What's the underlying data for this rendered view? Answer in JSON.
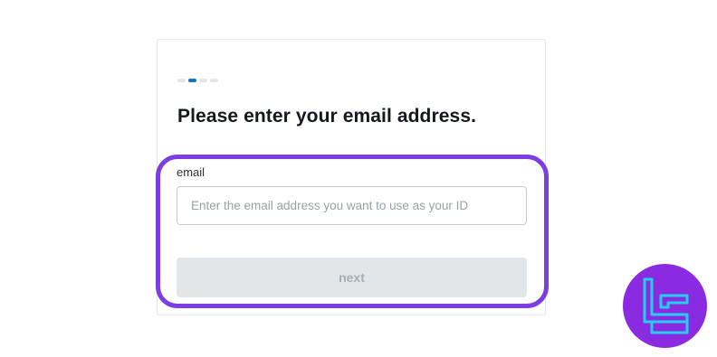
{
  "form": {
    "progress": {
      "total_steps": 4,
      "current_step": 2
    },
    "title": "Please enter your email address.",
    "email": {
      "label": "email",
      "value": "",
      "placeholder": "Enter the email address you want to use as your ID"
    },
    "next_label": "next",
    "next_enabled": false
  },
  "colors": {
    "accent": "#1a73c9",
    "highlight": "#7c3ee0",
    "logo_bg": "#8a2be2",
    "logo_mark": "#20d0f0",
    "button_disabled_bg": "#e3e6e9"
  },
  "logo": {
    "icon": "tc-monogram-icon"
  }
}
